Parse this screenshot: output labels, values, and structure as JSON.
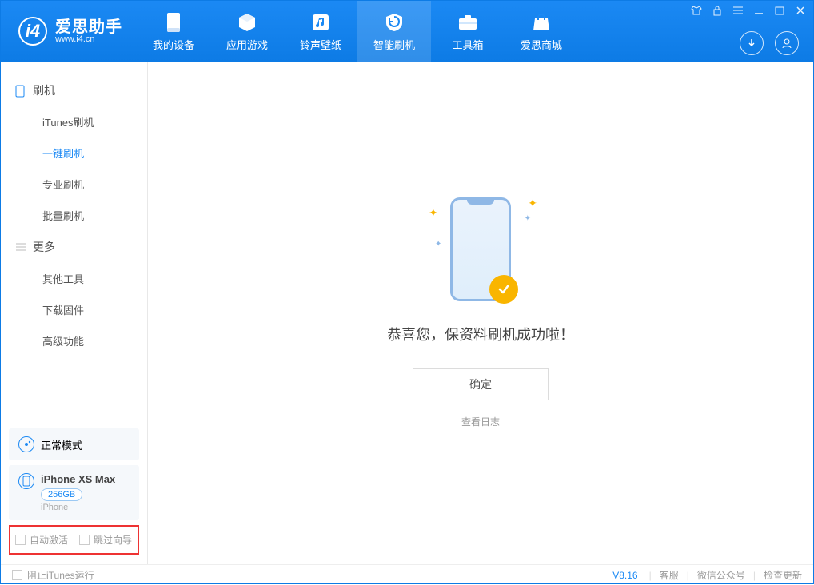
{
  "app": {
    "name": "爱思助手",
    "url": "www.i4.cn"
  },
  "nav": [
    {
      "label": "我的设备"
    },
    {
      "label": "应用游戏"
    },
    {
      "label": "铃声壁纸"
    },
    {
      "label": "智能刷机"
    },
    {
      "label": "工具箱"
    },
    {
      "label": "爱思商城"
    }
  ],
  "sidebar": {
    "section1": "刷机",
    "items1": [
      "iTunes刷机",
      "一键刷机",
      "专业刷机",
      "批量刷机"
    ],
    "section2": "更多",
    "items2": [
      "其他工具",
      "下载固件",
      "高级功能"
    ]
  },
  "mode_card": {
    "label": "正常模式"
  },
  "device_card": {
    "name": "iPhone XS Max",
    "storage": "256GB",
    "type": "iPhone"
  },
  "checks": {
    "auto_activate": "自动激活",
    "skip_guide": "跳过向导"
  },
  "main": {
    "message": "恭喜您，保资料刷机成功啦！",
    "ok": "确定",
    "view_log": "查看日志"
  },
  "footer": {
    "stop_itunes": "阻止iTunes运行",
    "version": "V8.16",
    "support": "客服",
    "wechat": "微信公众号",
    "check_update": "检查更新"
  }
}
